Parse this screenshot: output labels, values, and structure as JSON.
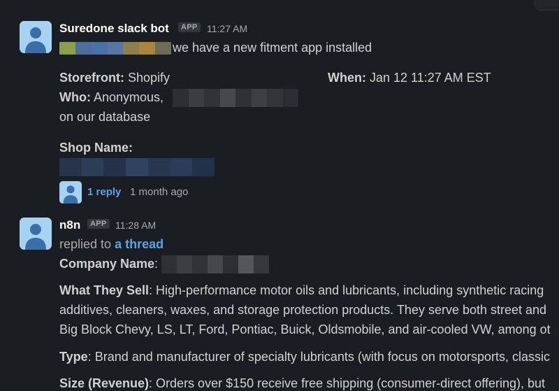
{
  "messages": [
    {
      "sender": "Suredone slack bot",
      "badge": "APP",
      "time": "11:27 AM",
      "intro_text": "we have a new fitment app installed",
      "storefront_label": "Storefront:",
      "storefront_value": " Shopify",
      "when_label": "When:",
      "when_value": " Jan 12 11:27 AM EST",
      "who_label": "Who:",
      "who_value": " Anonymous,",
      "who_line2": "on our database",
      "shop_name_label": "Shop Name:",
      "reply_count": "1 reply",
      "reply_time": "1 month ago",
      "avatar_icon": "person-avatar-icon"
    },
    {
      "sender": "n8n",
      "badge": "APP",
      "time": "11:28 AM",
      "replied_prefix": "replied to ",
      "replied_link": "a thread",
      "company_label": "Company Name",
      "company_sep": ":",
      "what_label": "What They Sell",
      "what_line1": ": High-performance motor oils and lubricants, including synthetic racing",
      "what_line2": "additives, cleaners, waxes, and storage protection products. They serve both street and",
      "what_line3": "Big Block Chevy, LS, LT, Ford, Pontiac, Buick, Oldsmobile, and air-cooled VW, among ot",
      "type_label": "Type",
      "type_value": ": Brand and manufacturer of specialty lubricants (with focus on motorsports, classic",
      "size_label": "Size (Revenue)",
      "size_value": ": Orders over $150 receive free shipping (consumer-direct offering), but",
      "avatar_icon": "person-avatar-icon"
    }
  ],
  "colors": {
    "background": "#1a1d21",
    "text": "#d1d2d3",
    "link": "#5da3e8",
    "avatar_bg": "#a7d3f2",
    "avatar_figure": "#3a6ea8"
  }
}
